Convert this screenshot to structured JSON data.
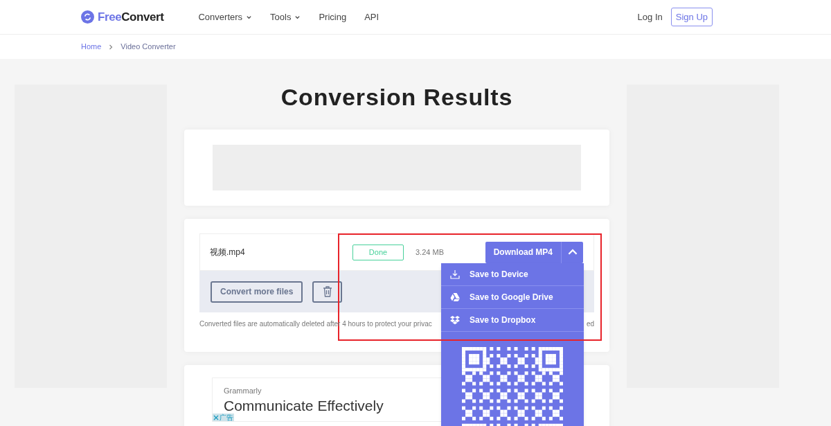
{
  "header": {
    "logo": {
      "first": "Free",
      "second": "Convert"
    },
    "nav": [
      {
        "label": "Converters",
        "has_menu": true
      },
      {
        "label": "Tools",
        "has_menu": true
      },
      {
        "label": "Pricing",
        "has_menu": false
      },
      {
        "label": "API",
        "has_menu": false
      }
    ],
    "login": "Log In",
    "signup": "Sign Up"
  },
  "breadcrumb": [
    "Home",
    "Video Converter"
  ],
  "title": "Conversion Results",
  "file": {
    "name": "视频.mp4",
    "status": "Done",
    "size": "3.24 MB",
    "download": "Download MP4",
    "menu_expanded": true
  },
  "actions": {
    "convert_more": "Convert more files"
  },
  "note": {
    "visible_start": "Converted files are automatically deleted after 4 hours to protect your privac",
    "visible_end": "ed"
  },
  "download_menu": [
    {
      "kind": "device",
      "label": "Save to Device"
    },
    {
      "kind": "drive",
      "label": "Save to Google Drive"
    },
    {
      "kind": "dropbox",
      "label": "Save to Dropbox"
    }
  ],
  "ad": {
    "brand": "Grammarly",
    "headline": "Communicate Effectively",
    "label": "广告"
  }
}
